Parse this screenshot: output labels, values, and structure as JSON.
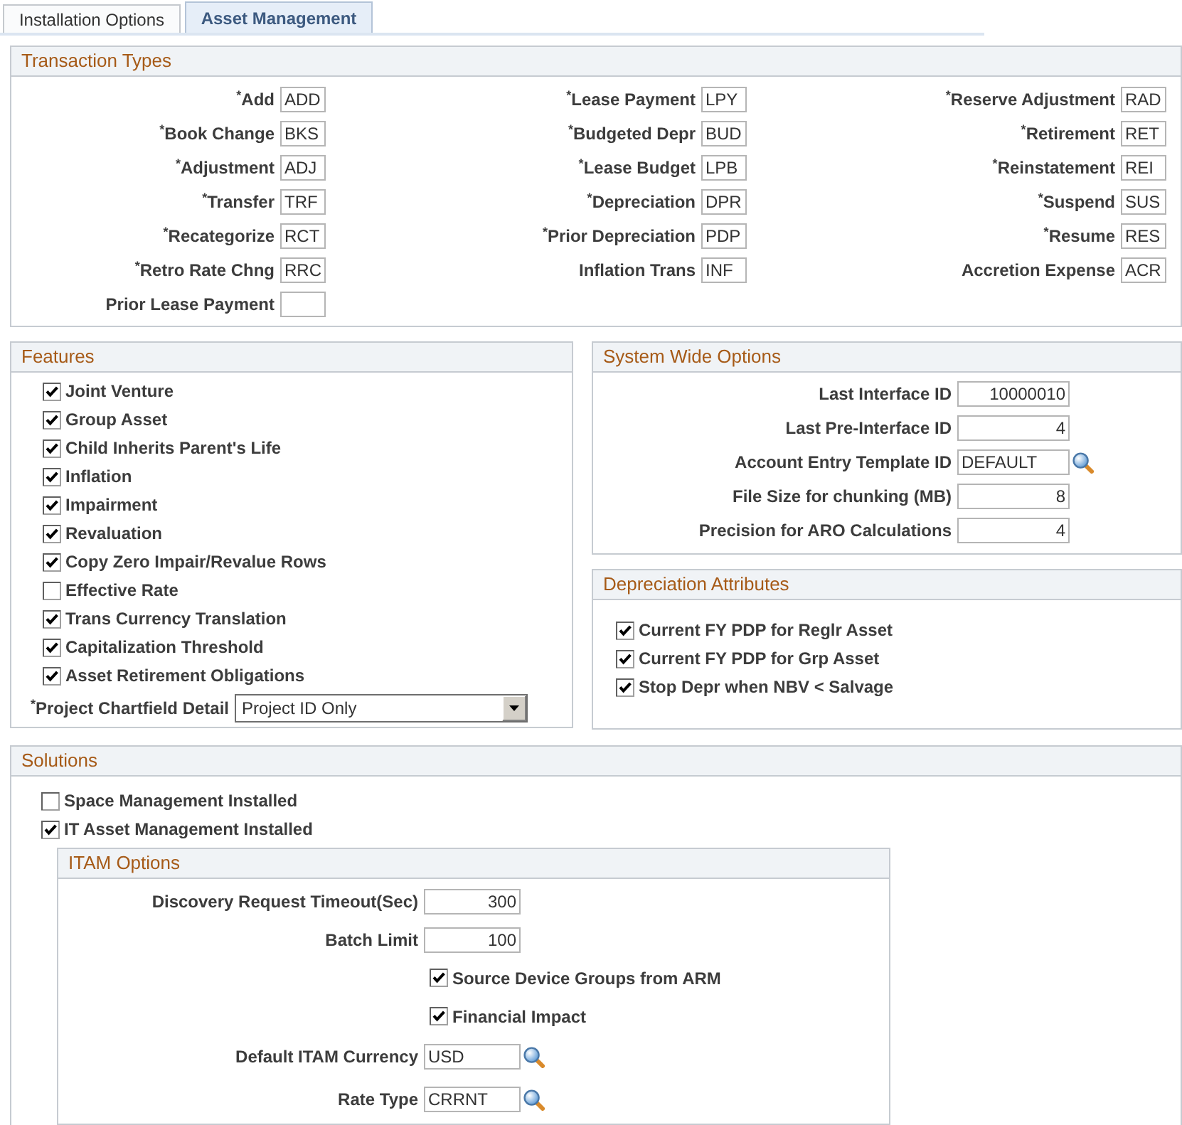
{
  "tabs": [
    {
      "label": "Installation Options",
      "selected": false
    },
    {
      "label": "Asset Management",
      "selected": true
    }
  ],
  "transaction_types": {
    "title": "Transaction Types",
    "fields": [
      {
        "label": "$^{*}$Add",
        "value": "ADD"
      },
      {
        "label": "$^{*}$Lease Payment",
        "value": "LPY"
      },
      {
        "label": "$^{*}$Reserve Adjustment",
        "value": "RAD"
      },
      {
        "label": "$^{*}$Book Change",
        "value": "BKS"
      },
      {
        "label": "$^{*}$Budgeted Depr",
        "value": "BUD"
      },
      {
        "label": "$^{*}$Retirement",
        "value": "RET"
      },
      {
        "label": "$^{*}$Adjustment",
        "value": "ADJ"
      },
      {
        "label": "$^{*}$Lease Budget",
        "value": "LPB"
      },
      {
        "label": "$^{*}$Reinstatement",
        "value": "REI"
      },
      {
        "label": "$^{*}$Transfer",
        "value": "TRF"
      },
      {
        "label": "$^{*}$Depreciation",
        "value": "DPR"
      },
      {
        "label": "$^{*}$Suspend",
        "value": "SUS"
      },
      {
        "label": "$^{*}$Recategorize",
        "value": "RCT"
      },
      {
        "label": "$^{*}$Prior Depreciation",
        "value": "PDP"
      },
      {
        "label": "$^{*}$Resume",
        "value": "RES"
      },
      {
        "label": "$^{*}$Retro Rate Chng",
        "value": "RRC"
      },
      {
        "label": "Inflation Trans",
        "value": "INF"
      },
      {
        "label": "Accretion Expense",
        "value": "ACR"
      },
      {
        "label": "Prior Lease Payment"
      }
    ]
  },
  "features": {
    "title": "Features",
    "options": [
      {
        "label": "Joint Venture",
        "checked": true
      },
      {
        "label": "Group Asset",
        "checked": true
      },
      {
        "label": "Child Inherits Parent's Life",
        "checked": true
      },
      {
        "label": "Inflation",
        "checked": true
      },
      {
        "label": "Impairment",
        "checked": true
      },
      {
        "label": "Revaluation",
        "checked": true
      },
      {
        "label": "Copy Zero Impair/Revalue Rows",
        "checked": true
      },
      {
        "label": "Effective Rate",
        "checked": false
      },
      {
        "label": "Trans Currency Translation",
        "checked": true
      },
      {
        "label": "Capitalization Threshold",
        "checked": true
      },
      {
        "label": "Asset Retirement Obligations",
        "checked": true
      }
    ],
    "project_chartfield_detail": {
      "label": "$^{*}$Project Chartfield Detail",
      "value": "Project ID Only"
    }
  },
  "system_wide_options": {
    "title": "System Wide Options",
    "fields": [
      {
        "kind": "number",
        "label": "Last Interface ID",
        "value": "10000010"
      },
      {
        "kind": "number",
        "label": "Last Pre-Interface ID",
        "value": "4"
      },
      {
        "kind": "lookup",
        "label": "Account Entry Template ID",
        "value": "DEFAULT"
      },
      {
        "kind": "number",
        "label": "File Size for chunking (MB)",
        "value": "8"
      },
      {
        "kind": "number",
        "label": "Precision for ARO Calculations",
        "value": "4"
      }
    ]
  },
  "depreciation_attributes": {
    "title": "Depreciation Attributes",
    "options": [
      {
        "label": "Current FY PDP for Reglr Asset",
        "checked": true
      },
      {
        "label": "Current FY PDP for Grp Asset",
        "checked": true
      },
      {
        "label": "Stop Depr when NBV < Salvage",
        "checked": true
      }
    ]
  },
  "solutions": {
    "title": "Solutions",
    "options": [
      {
        "label": "Space Management Installed",
        "checked": false
      },
      {
        "label": "IT Asset Management Installed",
        "checked": true
      }
    ],
    "itam_options": {
      "title": "ITAM Options",
      "items": [
        {
          "kind": "number",
          "label": "Discovery Request Timeout(Sec)",
          "value": "300"
        },
        {
          "kind": "number",
          "label": "Batch Limit",
          "value": "100"
        },
        {
          "kind": "checkbox",
          "label": "Source Device Groups from ARM",
          "checked": true
        },
        {
          "kind": "checkbox",
          "label": "Financial Impact",
          "checked": true
        },
        {
          "kind": "lookup",
          "label": "Default ITAM Currency",
          "value": "USD"
        },
        {
          "kind": "lookup",
          "label": "Rate Type",
          "value": "CRRNT"
        }
      ]
    }
  }
}
